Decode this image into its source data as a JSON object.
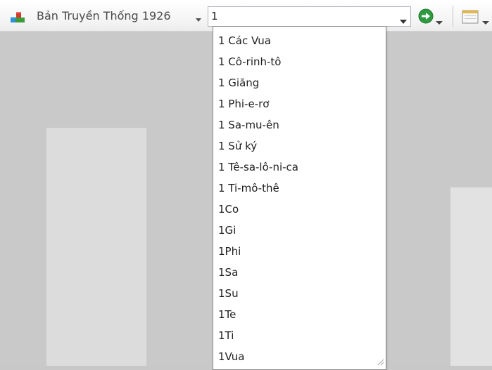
{
  "toolbar": {
    "version_label": "Bản Truyền Thống 1926",
    "book_input_value": "1",
    "icons": {
      "version": "bible-books-icon",
      "go": "go-arrow-icon",
      "view": "view-panel-icon",
      "dropdown": "chevron-down-icon"
    }
  },
  "dropdown": {
    "items": [
      "1 Các Vua",
      "1 Cô-rinh-tô",
      "1 Giăng",
      "1 Phi-e-rơ",
      "1 Sa-mu-ên",
      "1 Sử ký",
      "1 Tê-sa-lô-ni-ca",
      "1 Ti-mô-thê",
      "1Co",
      "1Gi",
      "1Phi",
      "1Sa",
      "1Su",
      "1Te",
      "1Ti",
      "1Vua"
    ]
  },
  "colors": {
    "background": "#c9c9c9",
    "panel": "#dcdcdc",
    "go_button": "#2e9a3f",
    "toolbar_text": "#4a4a4a"
  }
}
